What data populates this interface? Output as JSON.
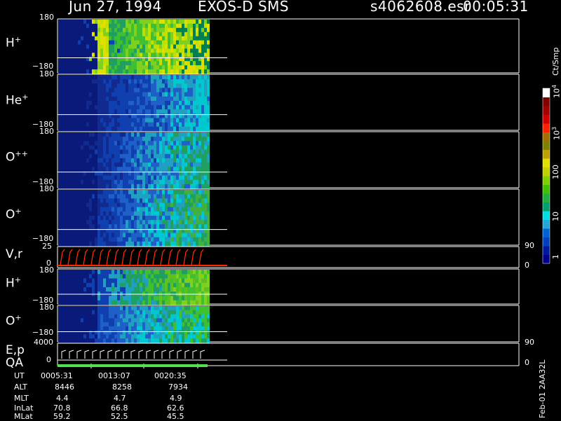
{
  "header": {
    "date": "Jun 27, 1994",
    "instrument": "EXOS-D SMS",
    "file": "s4062608.esr",
    "time": "00:05:31"
  },
  "colorbar": {
    "unit_label": "Ct/Smp",
    "labels": [
      "1",
      "10",
      "100",
      "10",
      "10"
    ],
    "exponents": [
      "3",
      "4"
    ],
    "colors": [
      "#00008b",
      "#0018a0",
      "#0040c0",
      "#0060d8",
      "#1fa8d8",
      "#00e0e0",
      "#00a070",
      "#20b040",
      "#40c000",
      "#80d000",
      "#c0d000",
      "#e0e000",
      "#c0a000",
      "#808000",
      "#a07000",
      "#ff2000",
      "#d00000",
      "#a00000",
      "#800000",
      "#ffffff"
    ]
  },
  "panels": [
    {
      "label": "H",
      "sup": "+",
      "top_tick": "180",
      "bottom_tick": "−180"
    },
    {
      "label": "He",
      "sup": "+",
      "top_tick": "180",
      "bottom_tick": "−180"
    },
    {
      "label": "O",
      "sup": "++",
      "top_tick": "180",
      "bottom_tick": "−180"
    },
    {
      "label": "O",
      "sup": "+",
      "top_tick": "180",
      "bottom_tick": "−180"
    },
    {
      "label": "V,r",
      "sup": "",
      "top_tick": "25",
      "bottom_tick": "0",
      "right_top": "90",
      "right_bottom": "0"
    },
    {
      "label": "H",
      "sup": "+",
      "top_tick": "180",
      "bottom_tick": "−180"
    },
    {
      "label": "O",
      "sup": "+",
      "top_tick": "180",
      "bottom_tick": "−180"
    },
    {
      "label": "E,p",
      "sup": "",
      "top_tick": "4000",
      "bottom_tick": "0",
      "right_top": "90",
      "right_bottom": "0"
    }
  ],
  "qa_label": "QA",
  "side_label": "Feb-01 2AA32L",
  "footer": {
    "rows": [
      {
        "name": "UT",
        "values": [
          "0005:31",
          "0013:07",
          "0020:35"
        ]
      },
      {
        "name": "ALT",
        "values": [
          "8446",
          "8258",
          "7934"
        ]
      },
      {
        "name": "MLT",
        "values": [
          "4.4",
          "4.7",
          "4.9"
        ]
      },
      {
        "name": "InLat",
        "values": [
          "70.8",
          "66.8",
          "62.6"
        ]
      },
      {
        "name": "MLat",
        "values": [
          "59.2",
          "52.5",
          "45.5"
        ]
      }
    ]
  },
  "chart_data": {
    "type": "heatmap",
    "title": "Jun 27, 1994   EXOS-D SMS",
    "time_ticks": [
      "0005:31",
      "0013:07",
      "0020:35"
    ],
    "data_time_range": [
      "0005:31",
      "about 0024:00"
    ],
    "pitch_angle_range": [
      -180,
      180
    ],
    "count_scale": "log",
    "count_range": [
      1,
      10000
    ],
    "panels": [
      {
        "species": "H+",
        "ylim": [
          -180,
          180
        ],
        "dominant_counts": "100-1000"
      },
      {
        "species": "He+",
        "ylim": [
          -180,
          180
        ],
        "dominant_counts": "1-10"
      },
      {
        "species": "O++",
        "ylim": [
          -180,
          180
        ],
        "dominant_counts": "1-10"
      },
      {
        "species": "O+",
        "ylim": [
          -180,
          180
        ],
        "dominant_counts": "1-30"
      },
      {
        "species": "V,r",
        "ylim": [
          0,
          25
        ],
        "right_ylim": [
          0,
          90
        ],
        "type": "line"
      },
      {
        "species": "H+",
        "ylim": [
          -180,
          180
        ],
        "dominant_counts": "10-300"
      },
      {
        "species": "O+",
        "ylim": [
          -180,
          180
        ],
        "dominant_counts": "1-30"
      },
      {
        "species": "E,p",
        "ylim": [
          0,
          4000
        ],
        "right_ylim": [
          0,
          90
        ],
        "type": "line"
      }
    ]
  }
}
